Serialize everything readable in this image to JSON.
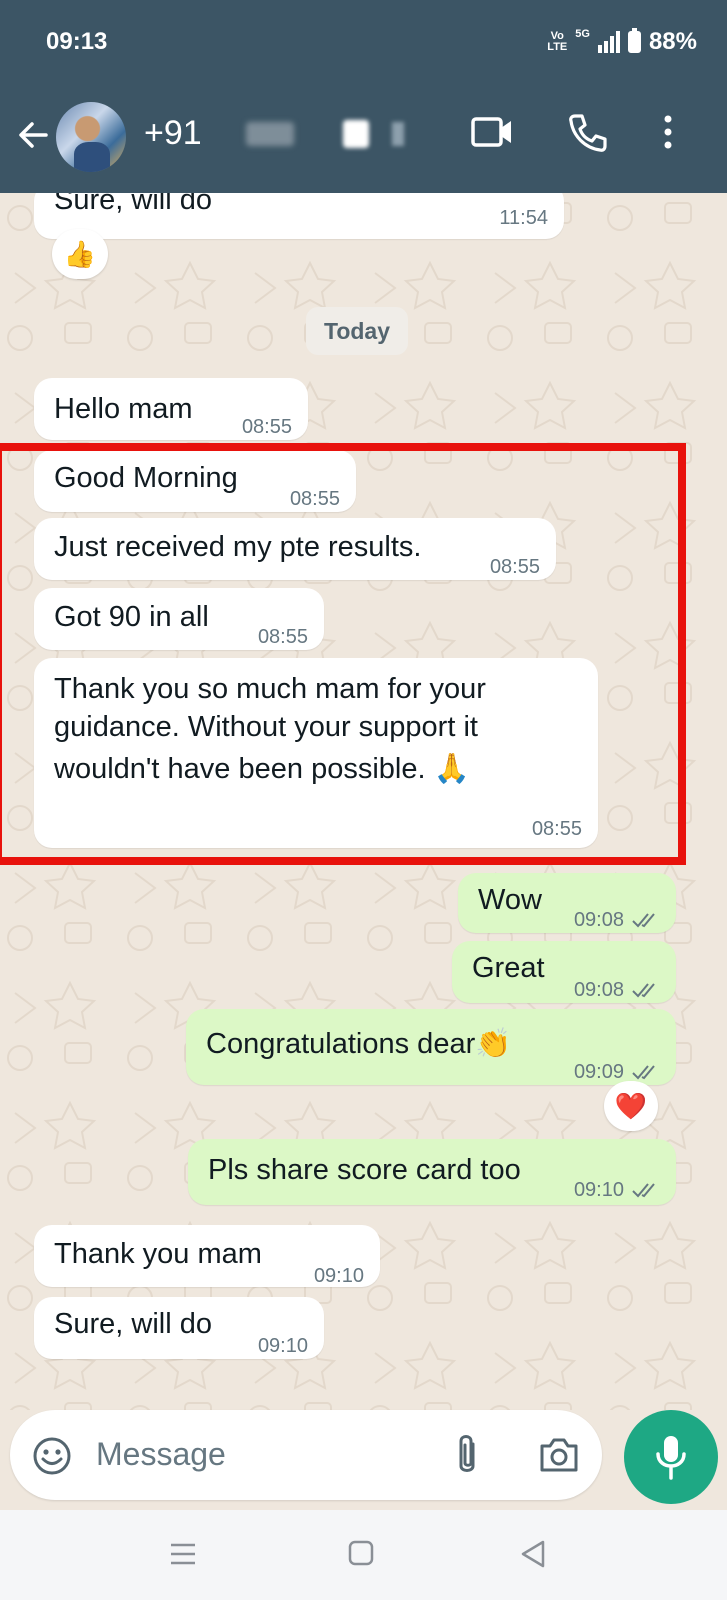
{
  "status_bar": {
    "time": "09:13",
    "volte": "Vo\nLTE",
    "network": "5G",
    "battery": "88%"
  },
  "header": {
    "contact_name": "+91"
  },
  "chat": {
    "date_divider": "Today",
    "messages": [
      {
        "text": "Sure, will do",
        "time": "11:54",
        "direction": "incoming"
      },
      {
        "text": "Hello mam",
        "time": "08:55",
        "direction": "incoming"
      },
      {
        "text": "Good Morning",
        "time": "08:55",
        "direction": "incoming"
      },
      {
        "text": "Just received my pte results.",
        "time": "08:55",
        "direction": "incoming"
      },
      {
        "text": "Got 90 in all",
        "time": "08:55",
        "direction": "incoming"
      },
      {
        "lines": [
          "Thank you so much mam for your",
          "guidance. Without your support it",
          "wouldn't have been possible. 🙏"
        ],
        "time": "08:55",
        "direction": "incoming"
      },
      {
        "text": "Wow",
        "time": "09:08",
        "direction": "outgoing",
        "status": "read"
      },
      {
        "text": "Great",
        "time": "09:08",
        "direction": "outgoing",
        "status": "read"
      },
      {
        "text": "Congratulations dear👏",
        "time": "09:09",
        "direction": "outgoing",
        "status": "read"
      },
      {
        "text": "Pls share score card too",
        "time": "09:10",
        "direction": "outgoing",
        "status": "read"
      },
      {
        "text": "Thank you mam",
        "time": "09:10",
        "direction": "incoming"
      },
      {
        "text": "Sure, will do",
        "time": "09:10",
        "direction": "incoming"
      }
    ],
    "reactions": {
      "thumbs": "👍",
      "heart": "❤️"
    }
  },
  "composer": {
    "placeholder": "Message"
  },
  "colors": {
    "header": "#3c5565",
    "outgoing_bubble": "#dcf8c6",
    "mic_button": "#1ea884",
    "highlight": "#e8120c"
  }
}
